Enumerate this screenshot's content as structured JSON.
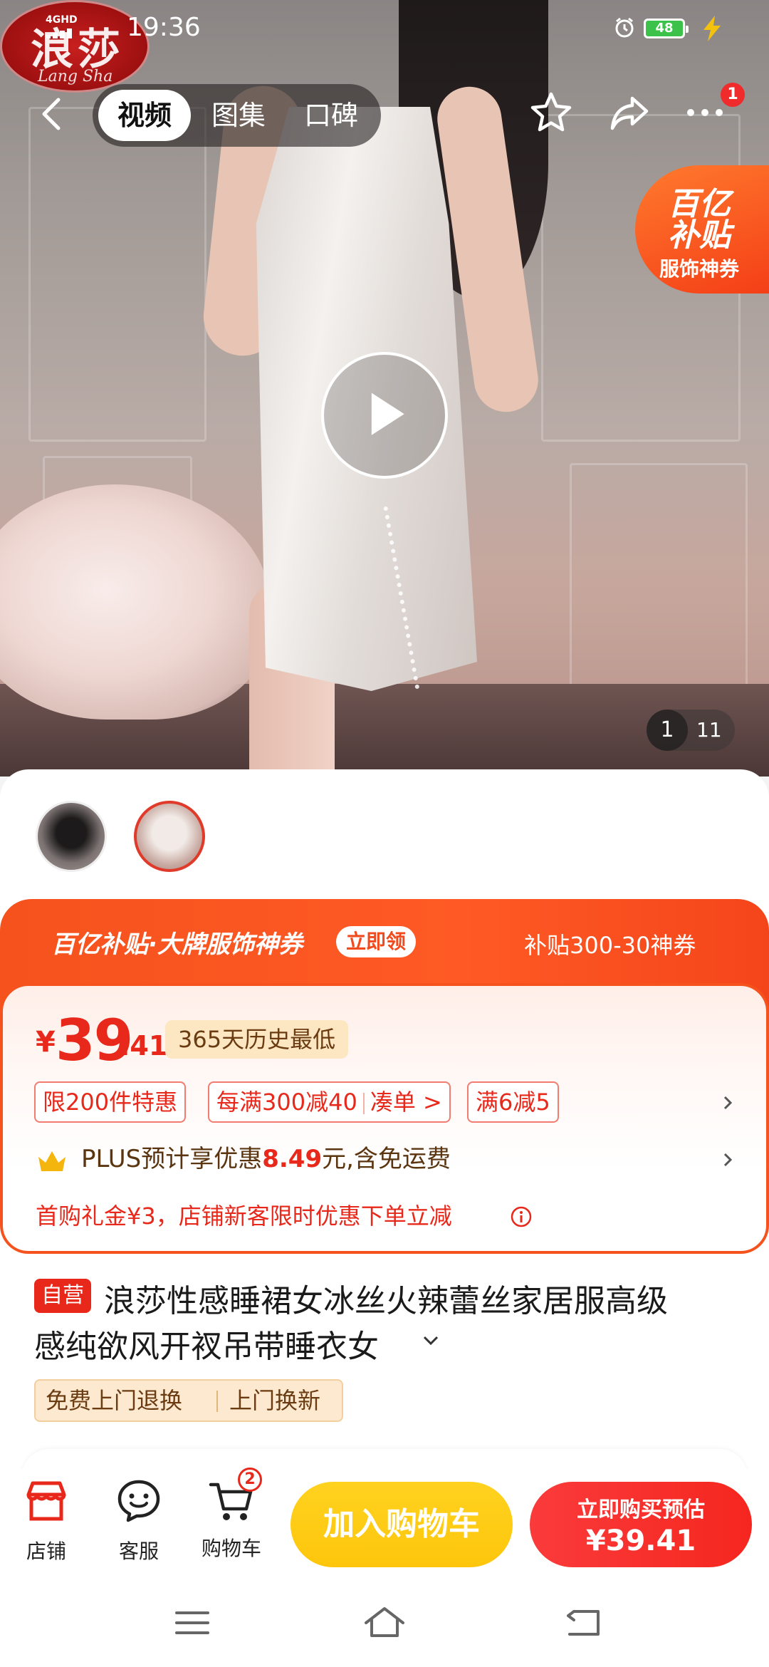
{
  "status_bar": {
    "network": "4GHD",
    "time": "19:36",
    "battery": "48"
  },
  "watermark": {
    "brand_cn": "浪莎",
    "brand_en": "Lang Sha"
  },
  "header": {
    "tabs": [
      {
        "label": "视频",
        "active": true
      },
      {
        "label": "图集",
        "active": false
      },
      {
        "label": "口碑",
        "active": false
      }
    ],
    "notification_count": "1",
    "icons": [
      "back-icon",
      "star-icon",
      "share-icon",
      "more-icon"
    ]
  },
  "subsidy_float": {
    "line1": "百亿",
    "line2": "补贴",
    "line3": "服饰神券"
  },
  "media": {
    "current": "1",
    "total": "11"
  },
  "promo": {
    "brand": "百亿补贴·大牌服饰神券",
    "claim_label": "立即领",
    "right_text": "补贴300-30神券"
  },
  "price": {
    "symbol": "¥",
    "integer": "39",
    "decimal": ".41",
    "low_tag": "365天历史最低"
  },
  "discount_chips": [
    "限200件特惠",
    "每满300减40",
    "凑单 >",
    "满6减5"
  ],
  "plus": {
    "prefix": "PLUS预计享优惠",
    "amount": "8.49",
    "suffix": "元,含免运费"
  },
  "gift": {
    "text": "首购礼金¥3，店铺新客限时优惠下单立减"
  },
  "product": {
    "self_tag": "自营",
    "title_line1": "浪莎性感睡裙女冰丝火辣蕾丝家居服高级",
    "title_line2": "感纯欲风开衩吊带睡衣女"
  },
  "services": {
    "a": "免费上门退换",
    "b": "上门换新"
  },
  "bottom_bar": {
    "shop": "店铺",
    "service": "客服",
    "cart": "购物车",
    "cart_count": "2",
    "add_cart": "加入购物车",
    "buy_line1": "立即购买预估",
    "buy_line2": "¥39.41"
  },
  "colors": {
    "accent_red": "#e8281a",
    "promo_orange": "#f5521d",
    "cart_yellow": "#fdc60c"
  }
}
